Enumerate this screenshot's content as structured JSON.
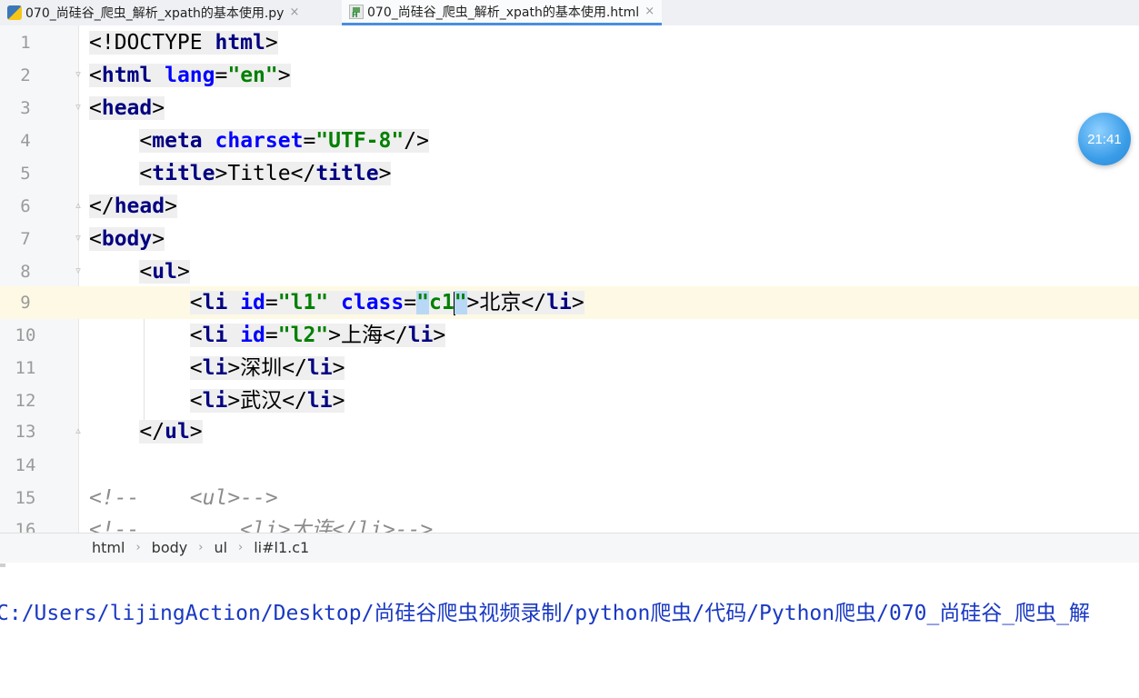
{
  "tabs": [
    {
      "label": "070_尚硅谷_爬虫_解析_xpath的基本使用.py",
      "icon": "python-file-icon",
      "active": false
    },
    {
      "label": "070_尚硅谷_爬虫_解析_xpath的基本使用.html",
      "icon": "html-file-icon",
      "active": true
    }
  ],
  "close_glyph": "×",
  "lines": [
    {
      "n": "1"
    },
    {
      "n": "2"
    },
    {
      "n": "3"
    },
    {
      "n": "4"
    },
    {
      "n": "5"
    },
    {
      "n": "6"
    },
    {
      "n": "7"
    },
    {
      "n": "8"
    },
    {
      "n": "9"
    },
    {
      "n": "10"
    },
    {
      "n": "11"
    },
    {
      "n": "12"
    },
    {
      "n": "13"
    },
    {
      "n": "14"
    },
    {
      "n": "15"
    },
    {
      "n": "16"
    }
  ],
  "code": {
    "l1": {
      "open": "<!DOCTYPE ",
      "kw": "html",
      "close": ">"
    },
    "l2": {
      "lt": "<",
      "tag": "html",
      "sp": " ",
      "attr": "lang",
      "eq": "=",
      "val": "\"en\"",
      "gt": ">"
    },
    "l3": {
      "lt": "<",
      "tag": "head",
      "gt": ">"
    },
    "l4": {
      "indent": "    ",
      "lt": "<",
      "tag": "meta",
      "sp": " ",
      "attr": "charset",
      "eq": "=",
      "val": "\"UTF-8\"",
      "gt": "/>"
    },
    "l5": {
      "indent": "    ",
      "lt": "<",
      "tag": "title",
      "gt": ">",
      "text": "Title",
      "lt2": "</",
      "tag2": "title",
      "gt2": ">"
    },
    "l6": {
      "lt": "</",
      "tag": "head",
      "gt": ">"
    },
    "l7": {
      "lt": "<",
      "tag": "body",
      "gt": ">"
    },
    "l8": {
      "indent": "    ",
      "lt": "<",
      "tag": "ul",
      "gt": ">"
    },
    "l9": {
      "indent": "        ",
      "lt": "<",
      "tag": "li",
      "sp": " ",
      "attr": "id",
      "eq": "=",
      "val": "\"l1\"",
      "sp2": " ",
      "attr2": "class",
      "eq2": "=",
      "q1": "\"",
      "val2": "c1",
      "q2": "\"",
      "gt": ">",
      "text": "北京",
      "lt2": "</",
      "tag2": "li",
      "gt2": ">"
    },
    "l10": {
      "indent": "        ",
      "lt": "<",
      "tag": "li",
      "sp": " ",
      "attr": "id",
      "eq": "=",
      "val": "\"l2\"",
      "gt": ">",
      "text": "上海",
      "lt2": "</",
      "tag2": "li",
      "gt2": ">"
    },
    "l11": {
      "indent": "        ",
      "lt": "<",
      "tag": "li",
      "gt": ">",
      "text": "深圳",
      "lt2": "</",
      "tag2": "li",
      "gt2": ">"
    },
    "l12": {
      "indent": "        ",
      "lt": "<",
      "tag": "li",
      "gt": ">",
      "text": "武汉",
      "lt2": "</",
      "tag2": "li",
      "gt2": ">"
    },
    "l13": {
      "indent": "    ",
      "lt": "</",
      "tag": "ul",
      "gt": ">"
    },
    "l15": {
      "text": "<!--    <ul>-->"
    },
    "l16": {
      "text": "<!--        <li>大连</li>-->"
    }
  },
  "timer": "21:41",
  "breadcrumb": [
    "html",
    "body",
    "ul",
    "li#l1.c1"
  ],
  "breadcrumb_sep": "›",
  "console": {
    "text": "C:/Users/lijingAction/Desktop/尚硅谷爬虫视频录制/python爬虫/代码/Python爬虫/070_尚硅谷_爬虫_解"
  },
  "colors": {
    "tag": "#000080",
    "attr": "#0000ff",
    "value": "#008000",
    "current_line": "#fdf9e4",
    "console_text": "#1a39c2"
  }
}
